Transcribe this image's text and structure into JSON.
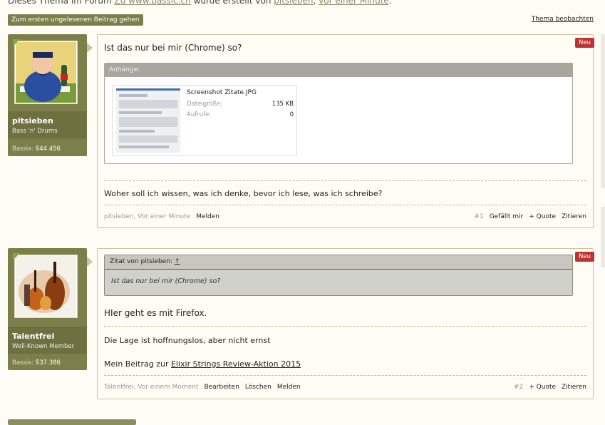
{
  "header": {
    "prefix": "Dieses Thema im Forum ",
    "forum": "Zu www.bassic.ch",
    "middle": " wurde erstellt von ",
    "author": "pitsieben",
    "sep": ", ",
    "time": "vor einer Minute",
    "end": "."
  },
  "buttons": {
    "first_unread": "Zum ersten ungelesenen Beitrag gehen",
    "watch": "Thema beobachten"
  },
  "posts": [
    {
      "username": "pitsieben",
      "usertitle": "Bass 'n' Drums",
      "bassix_label": "Bassix:",
      "bassix_value": "ß44.456",
      "badge": "Neu",
      "message": "Ist das nur bei mir (Chrome) so?",
      "attachments_label": "Anhänge:",
      "attachment": {
        "filename": "Screenshot Zitate.JPG",
        "size_label": "Dateigröße:",
        "size_value": "135 KB",
        "views_label": "Aufrufe:",
        "views_value": "0"
      },
      "signature": "Woher soll ich wissen, was ich denke, bevor ich lese, was ich schreibe?",
      "footer_meta": "pitsieben, Vor einer Minute",
      "actions_left": [
        "Melden"
      ],
      "number": "#1",
      "actions_right": [
        "Gefällt mir",
        "+ Quote",
        "Zitieren"
      ]
    },
    {
      "username": "Talentfrei",
      "usertitle": "Well-Known Member",
      "bassix_label": "Bassix:",
      "bassix_value": "ß37.386",
      "badge": "Neu",
      "quote_header": "Zitat von pitsieben: ",
      "quote_link": "↑",
      "quote_text": "Ist das nur bei mir (Chrome) so?",
      "message": "HIer geht es mit Firefox.",
      "signature_line1": "Die Lage ist hoffnungslos, aber nicht ernst",
      "signature_prefix": "Mein Beitrag zur ",
      "signature_link": "Elixir Strings Review-Aktion 2015",
      "footer_meta": "Talentfrei, Vor einem Moment",
      "actions_left": [
        "Bearbeiten",
        "Löschen",
        "Melden"
      ],
      "number": "#2",
      "actions_right": [
        "+ Quote",
        "Zitieren"
      ]
    }
  ]
}
